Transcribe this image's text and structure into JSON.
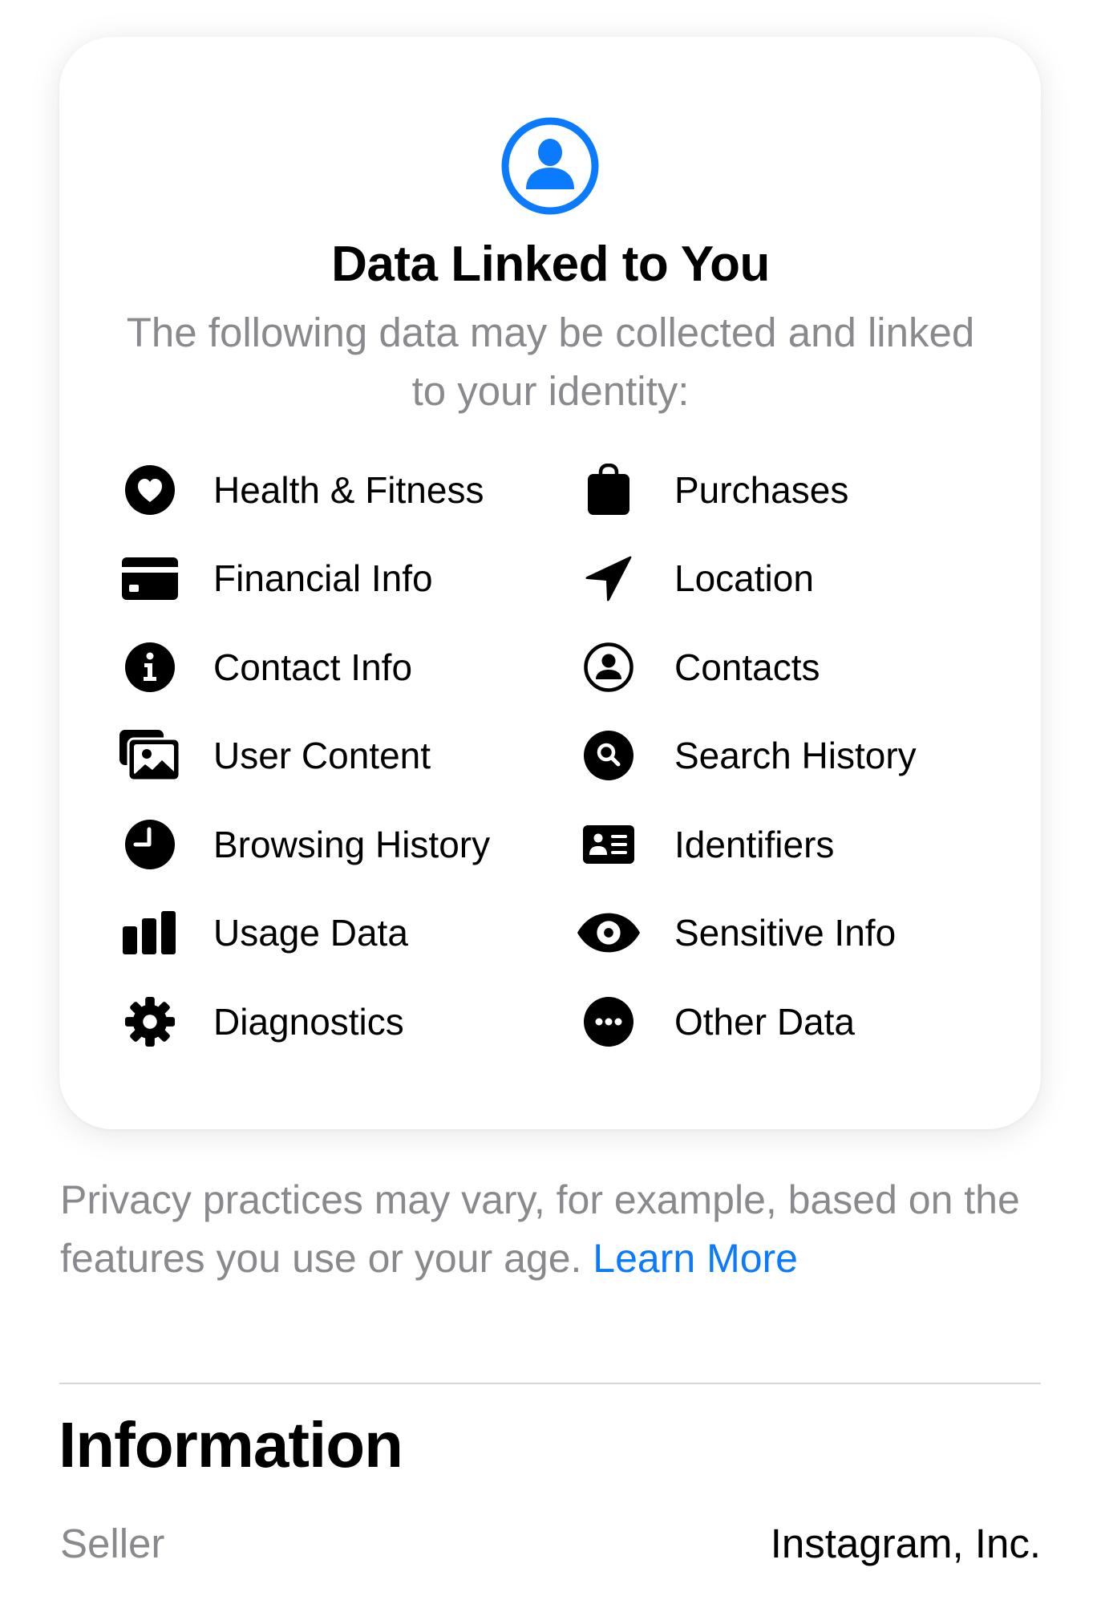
{
  "privacy_card": {
    "icon": "person-circle-icon",
    "accent_color": "#0a7aff",
    "title": "Data Linked to You",
    "subtitle": "The following data may be collected and linked to your identity:",
    "left_column": [
      {
        "label": "Health & Fitness",
        "icon": "heart-circle-icon"
      },
      {
        "label": "Financial Info",
        "icon": "credit-card-icon"
      },
      {
        "label": "Contact Info",
        "icon": "info-circle-icon"
      },
      {
        "label": "User Content",
        "icon": "photos-icon"
      },
      {
        "label": "Browsing History",
        "icon": "clock-icon"
      },
      {
        "label": "Usage Data",
        "icon": "bar-chart-icon"
      },
      {
        "label": "Diagnostics",
        "icon": "gear-icon"
      }
    ],
    "right_column": [
      {
        "label": "Purchases",
        "icon": "shopping-bag-icon"
      },
      {
        "label": "Location",
        "icon": "location-arrow-icon"
      },
      {
        "label": "Contacts",
        "icon": "person-circle-outline-icon"
      },
      {
        "label": "Search History",
        "icon": "search-circle-icon"
      },
      {
        "label": "Identifiers",
        "icon": "id-card-icon"
      },
      {
        "label": "Sensitive Info",
        "icon": "eye-icon"
      },
      {
        "label": "Other Data",
        "icon": "ellipsis-circle-icon"
      }
    ]
  },
  "footer": {
    "text": "Privacy practices may vary, for example, based on the features you use or your age. ",
    "link_label": "Learn More",
    "link_color": "#0a7aff"
  },
  "information": {
    "title": "Information",
    "rows": [
      {
        "key": "Seller",
        "value": "Instagram, Inc."
      }
    ]
  }
}
